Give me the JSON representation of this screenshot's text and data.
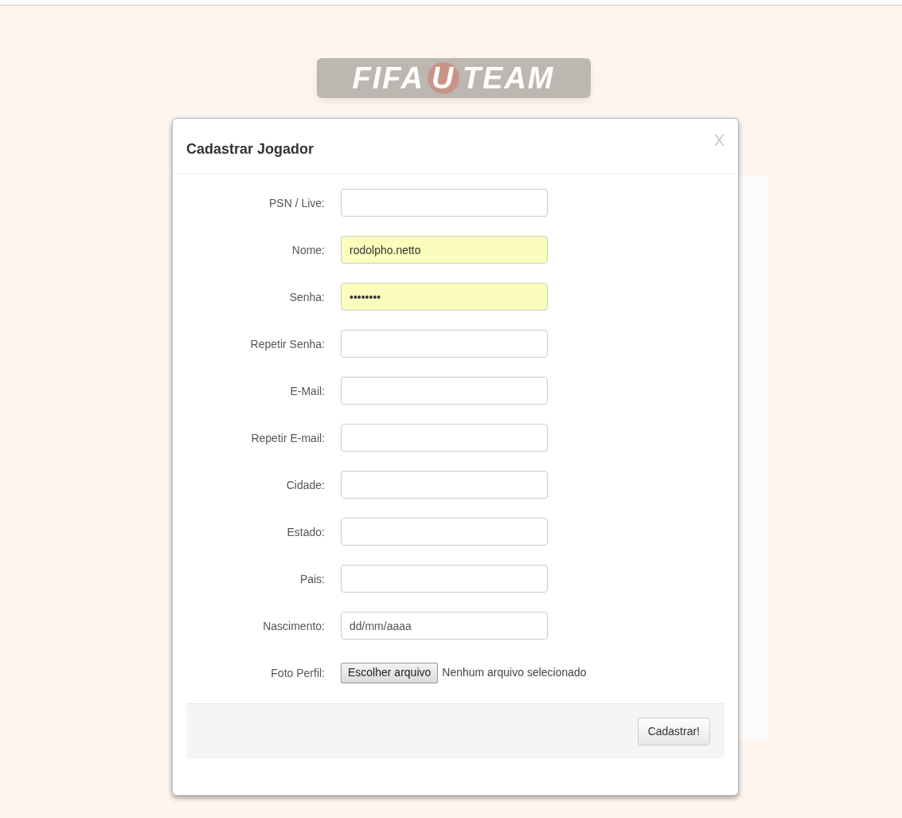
{
  "logo": {
    "parts": [
      "FIFA",
      "U",
      "TEAM"
    ]
  },
  "modal": {
    "title": "Cadastrar Jogador",
    "close": "X",
    "fields": [
      {
        "kind": "text",
        "label": "PSN / Live:",
        "autofilled": false
      },
      {
        "kind": "text",
        "label": "Nome:",
        "value": "rodolpho.netto",
        "autofilled": true
      },
      {
        "kind": "text",
        "label": "Senha:",
        "value": "••••••••",
        "autofilled": true
      },
      {
        "kind": "text",
        "label": "Repetir Senha:",
        "autofilled": false
      },
      {
        "kind": "text",
        "label": "E-Mail:",
        "autofilled": false
      },
      {
        "kind": "text",
        "label": "Repetir E-mail:",
        "autofilled": false
      },
      {
        "kind": "text",
        "label": "Cidade:",
        "autofilled": false
      },
      {
        "kind": "text",
        "label": "Estado:",
        "autofilled": false
      },
      {
        "kind": "text",
        "label": "Pais:",
        "autofilled": false
      },
      {
        "kind": "text",
        "label": "Nascimento:",
        "placeholder": "dd/mm/aaaa",
        "autofilled": false
      },
      {
        "kind": "file",
        "label": "Foto Perfil:",
        "button": "Escolher arquivo",
        "status": "Nenhum arquivo selecionado"
      }
    ],
    "submit": "Cadastrar!"
  }
}
